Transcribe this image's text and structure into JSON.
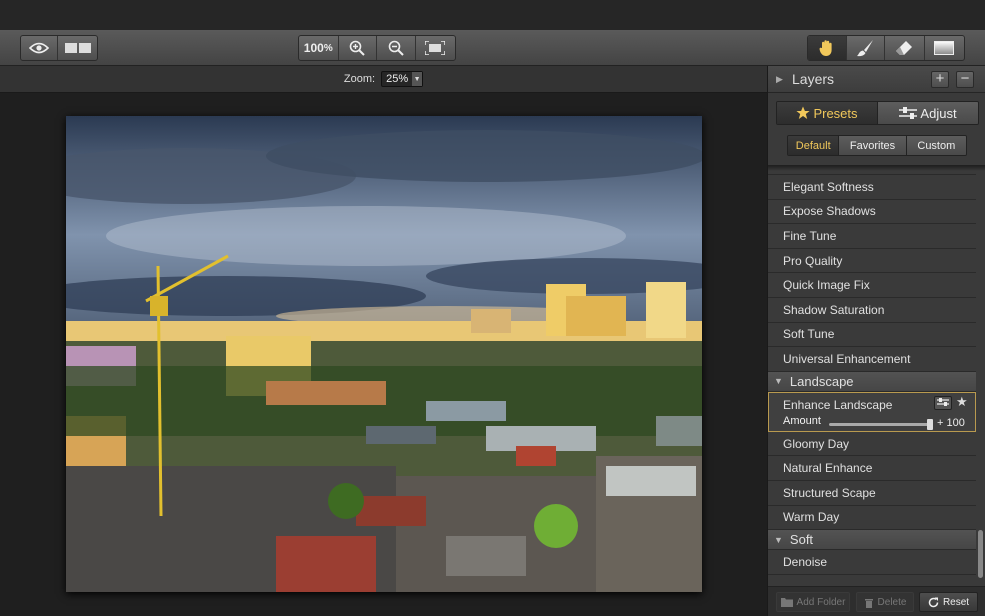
{
  "toolbar": {
    "zoom_percent": "100",
    "zoom_percent_suffix": "%"
  },
  "canvas": {
    "zoom_label": "Zoom:",
    "zoom_value": "25%"
  },
  "layers": {
    "title": "Layers",
    "add_symbol": "+",
    "remove_symbol": "−"
  },
  "tabs": {
    "presets": "Presets",
    "adjust": "Adjust",
    "presets_icon": "star-icon",
    "adjust_icon": "sliders-icon"
  },
  "filter_tabs": {
    "default": "Default",
    "favorites": "Favorites",
    "custom": "Custom"
  },
  "presets": {
    "group1_items": [
      "Elegant Softness",
      "Expose Shadows",
      "Fine Tune",
      "Pro Quality",
      "Quick Image Fix",
      "Shadow Saturation",
      "Soft Tune",
      "Universal Enhancement"
    ],
    "landscape_label": "Landscape",
    "selected": {
      "name": "Enhance Landscape",
      "amount_label": "Amount",
      "amount_value": "+ 100",
      "amount_fraction": 1.0
    },
    "landscape_items": [
      "Gloomy Day",
      "Natural Enhance",
      "Structured Scape",
      "Warm Day"
    ],
    "soft_label": "Soft",
    "soft_items": [
      "Denoise"
    ]
  },
  "bottom": {
    "add_folder": "Add Folder",
    "delete": "Delete",
    "reset": "Reset"
  },
  "colors": {
    "accent": "#f1c85b",
    "selected_border": "#b99a4f"
  }
}
